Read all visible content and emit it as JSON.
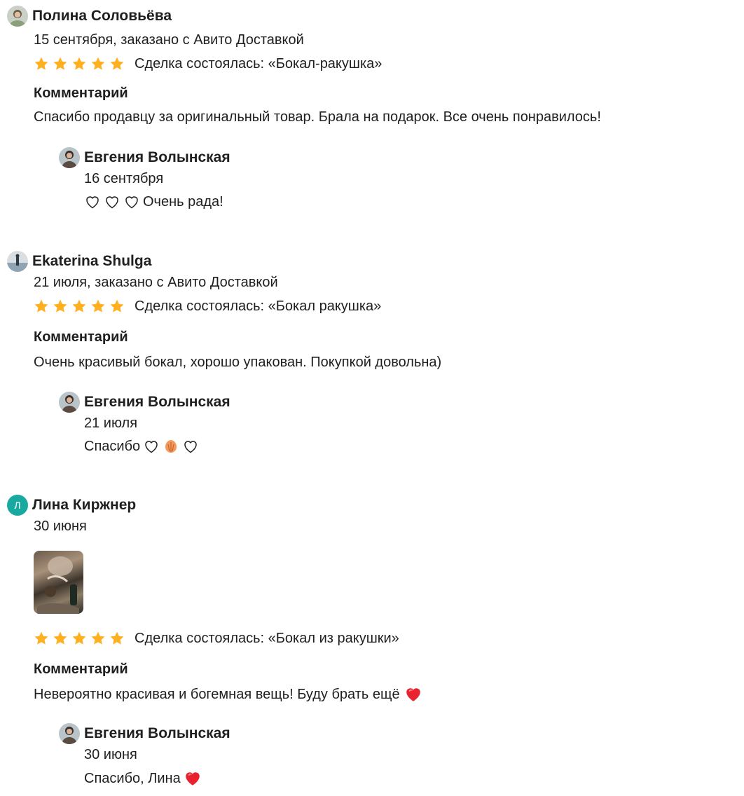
{
  "reviews": [
    {
      "author": "Полина Соловьёва",
      "meta": "15 сентября, заказано с Авито Доставкой",
      "deal": "Сделка состоялась: «Бокал-ракушка»",
      "comment_title": "Комментарий",
      "comment": "Спасибо продавцу за оригинальный товар. Брала на подарок. Все очень понравилось!",
      "rating": 5,
      "reply": {
        "author": "Евгения Волынская",
        "date": "16 сентября",
        "text": "Очень рада!"
      }
    },
    {
      "author": "Ekaterina Shulga",
      "meta": "21 июля, заказано с Авито Доставкой",
      "deal": "Сделка состоялась: «Бокал ракушка»",
      "comment_title": "Комментарий",
      "comment": "Очень красивый бокал, хорошо упакован. Покупкой довольна)",
      "rating": 5,
      "reply": {
        "author": "Евгения Волынская",
        "date": "21 июля",
        "text": "Спасибо"
      }
    },
    {
      "author": "Лина Киржнер",
      "avatar_letter": "Л",
      "meta": "30 июня",
      "deal": "Сделка состоялась: «Бокал из ракушки»",
      "comment_title": "Комментарий",
      "comment": "Невероятно красивая и богемная вещь! Буду брать ещё",
      "rating": 5,
      "reply": {
        "author": "Евгения Волынская",
        "date": "30 июня",
        "text": "Спасибо, Лина"
      }
    }
  ],
  "colors": {
    "star": "#ffb021",
    "heart_red": "#e8222e",
    "avatar_teal": "#1aa9a0",
    "text": "#1f1f1f"
  }
}
